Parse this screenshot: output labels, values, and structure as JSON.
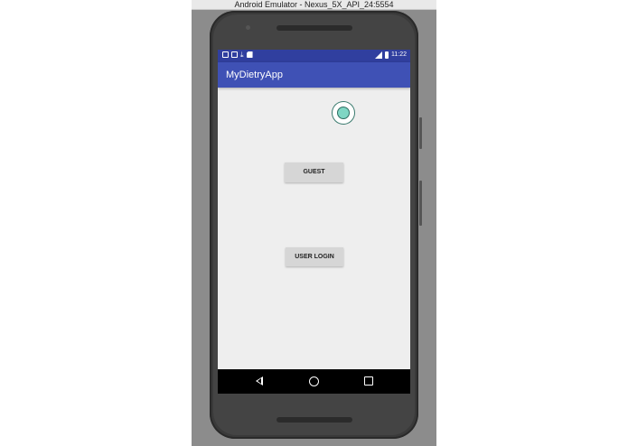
{
  "window": {
    "title": "Android Emulator - Nexus_5X_API_24:5554"
  },
  "status_bar": {
    "time": "11:22"
  },
  "app_bar": {
    "title": "MyDietryApp"
  },
  "buttons": {
    "guest": "GUEST",
    "user_login": "USER LOGIN"
  },
  "colors": {
    "status_bar": "#303f9f",
    "app_bar": "#3f51b5",
    "screen_bg": "#eeeeee",
    "touch_indicator": "#7fd6c4"
  },
  "icons": {
    "status_left": [
      "notification-icon",
      "notification-icon",
      "download-icon",
      "sd-card-icon"
    ],
    "status_right": [
      "signal-icon",
      "battery-icon"
    ],
    "navigation": [
      "back-icon",
      "home-icon",
      "recents-icon"
    ]
  }
}
